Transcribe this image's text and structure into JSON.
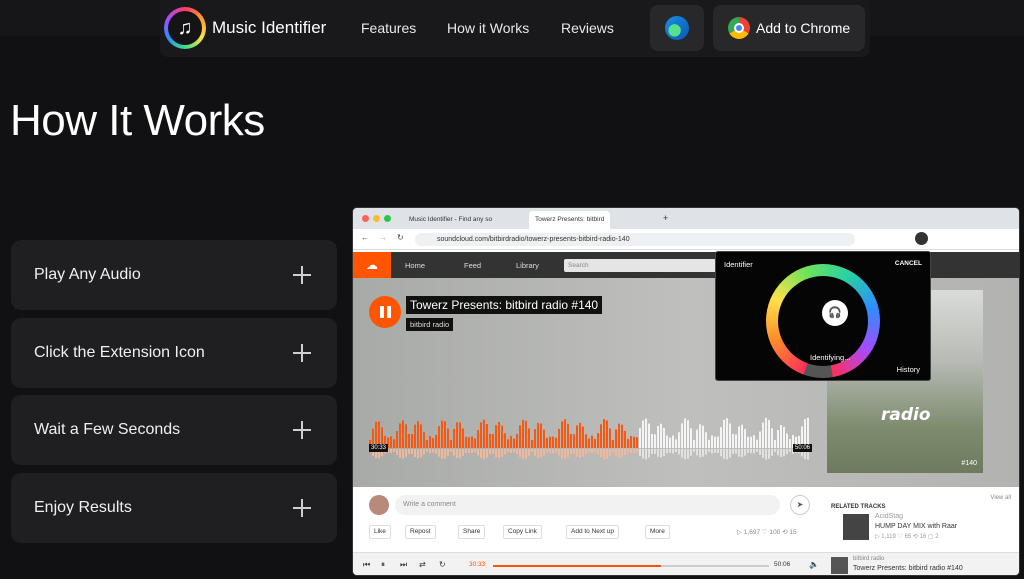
{
  "nav": {
    "brand": "Music Identifier",
    "links": [
      "Features",
      "How it Works",
      "Reviews"
    ],
    "chrome_button": "Add to Chrome"
  },
  "page_title": "How It Works",
  "steps": [
    {
      "label": "Play Any Audio"
    },
    {
      "label": "Click the Extension Icon"
    },
    {
      "label": "Wait a Few Seconds"
    },
    {
      "label": "Enjoy Results"
    }
  ],
  "demo": {
    "browser_tabs": [
      "Music Identifier - Find any so",
      "Towerz Presents: bitbird"
    ],
    "url": "soundcloud.com/bitbirdradio/towerz-presents-bitbird-radio-140",
    "sc_nav": [
      "Home",
      "Feed",
      "Library"
    ],
    "sc_search_placeholder": "Search",
    "track_title": "Towerz Presents: bitbird radio #140",
    "track_artist": "bitbird radio",
    "artwork_word": "radio",
    "artwork_number": "#140",
    "waveform_time_left": "30:33",
    "waveform_time_right": "50:06",
    "comment_placeholder": "Write a comment",
    "actions": [
      "Like",
      "Repost",
      "Share",
      "Copy Link",
      "Add to Next up",
      "More"
    ],
    "stats": "▷ 1,697   ♡ 100   ⟲ 15",
    "related": {
      "heading": "RELATED TRACKS",
      "view_all": "View all",
      "artist": "AcidStag",
      "title": "HUMP DAY MIX with Raar",
      "stats": "▷ 1,119   ♡ 65   ⟲ 16   ▢ 2"
    },
    "player": {
      "time_now": "30:33",
      "time_total": "50:06",
      "progress": 0.61,
      "artist": "bitbird radio",
      "title": "Towerz Presents: bitbird radio #140"
    },
    "popup": {
      "brand": "Identifier",
      "cancel": "CANCEL",
      "status": "Identifying...",
      "history": "History"
    }
  }
}
